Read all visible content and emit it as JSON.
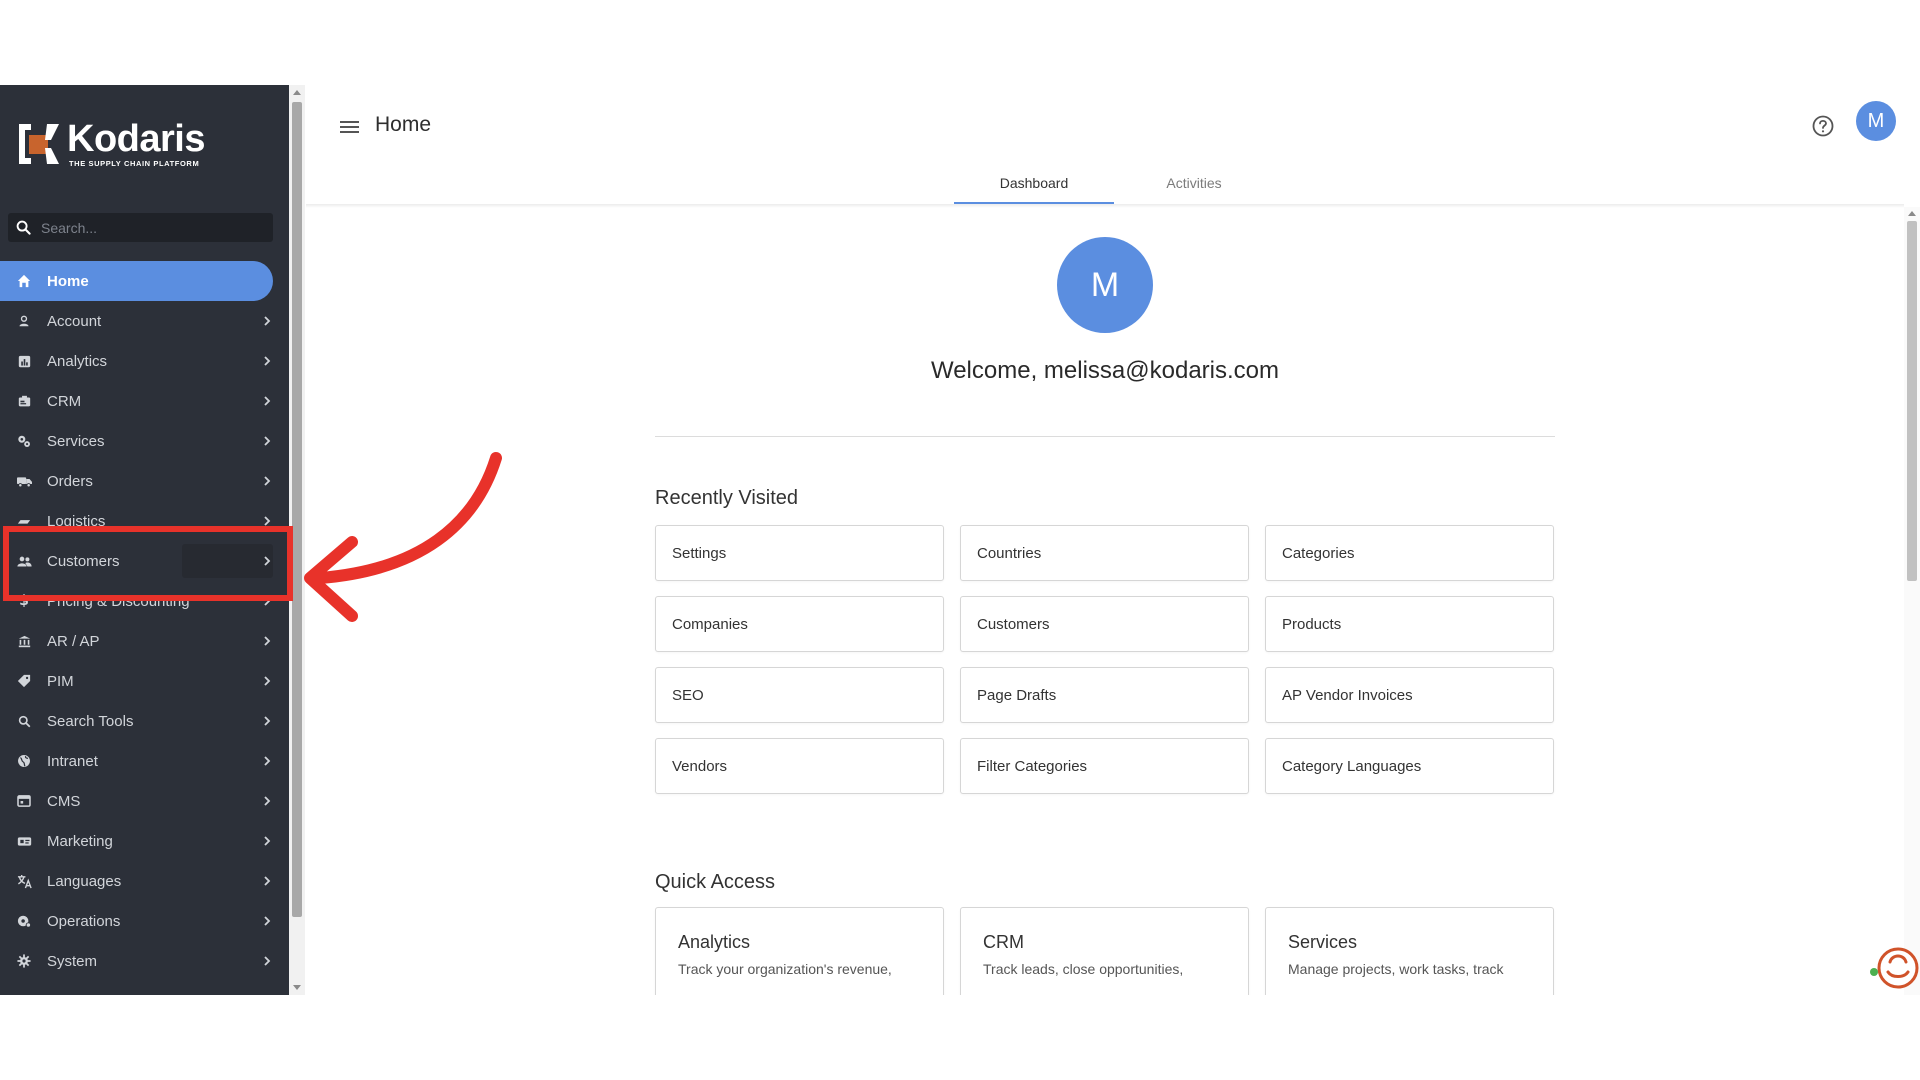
{
  "brand": {
    "name": "Kodaris",
    "tagline": "THE SUPPLY CHAIN PLATFORM"
  },
  "search": {
    "placeholder": "Search..."
  },
  "sidebar": {
    "items": [
      {
        "label": "Home",
        "icon": "home-icon"
      },
      {
        "label": "Account",
        "icon": "person-icon"
      },
      {
        "label": "Analytics",
        "icon": "analytics-icon"
      },
      {
        "label": "CRM",
        "icon": "crm-icon"
      },
      {
        "label": "Services",
        "icon": "gears-icon"
      },
      {
        "label": "Orders",
        "icon": "truck-icon"
      },
      {
        "label": "Logistics",
        "icon": "logistics-icon"
      },
      {
        "label": "Customers",
        "icon": "people-icon"
      },
      {
        "label": "Pricing & Discounting",
        "icon": "dollar-icon"
      },
      {
        "label": "AR / AP",
        "icon": "bank-icon"
      },
      {
        "label": "PIM",
        "icon": "tag-icon"
      },
      {
        "label": "Search Tools",
        "icon": "search-icon"
      },
      {
        "label": "Intranet",
        "icon": "globe-icon"
      },
      {
        "label": "CMS",
        "icon": "cms-icon"
      },
      {
        "label": "Marketing",
        "icon": "megaphone-icon"
      },
      {
        "label": "Languages",
        "icon": "translate-icon"
      },
      {
        "label": "Operations",
        "icon": "operations-icon"
      },
      {
        "label": "System",
        "icon": "gear-icon"
      }
    ]
  },
  "header": {
    "title": "Home",
    "avatar_initial": "M"
  },
  "tabs": [
    {
      "label": "Dashboard"
    },
    {
      "label": "Activities"
    }
  ],
  "profile": {
    "avatar_initial": "M",
    "welcome": "Welcome, melissa@kodaris.com"
  },
  "recently_visited": {
    "title": "Recently Visited",
    "items": [
      "Settings",
      "Countries",
      "Categories",
      "Companies",
      "Customers",
      "Products",
      "SEO",
      "Page Drafts",
      "AP Vendor Invoices",
      "Vendors",
      "Filter Categories",
      "Category Languages"
    ]
  },
  "quick_access": {
    "title": "Quick Access",
    "items": [
      {
        "title": "Analytics",
        "desc": "Track your organization's revenue,"
      },
      {
        "title": "CRM",
        "desc": "Track leads, close opportunities,"
      },
      {
        "title": "Services",
        "desc": "Manage projects, work tasks, track"
      }
    ]
  },
  "colors": {
    "sidebar_bg": "#2c3039",
    "accent": "#5b8ee0",
    "highlight": "#e8322a",
    "logo_orange": "#c8642d"
  }
}
